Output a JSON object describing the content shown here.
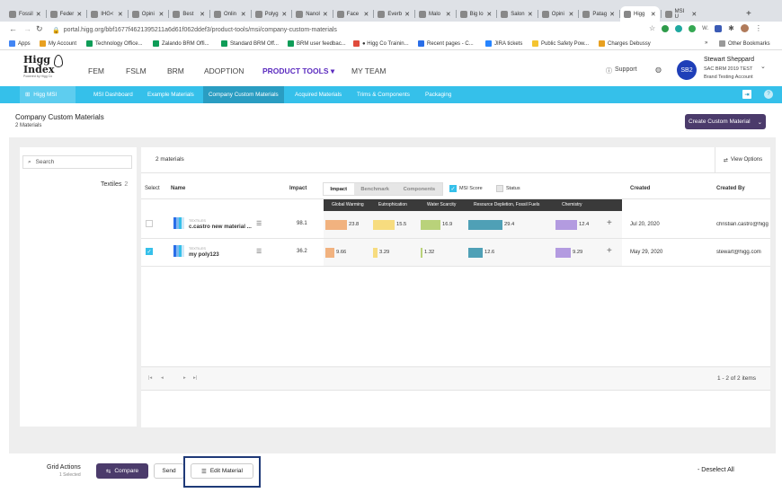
{
  "browser": {
    "tabs": [
      {
        "label": "Fossil",
        "icon": "qz-icon"
      },
      {
        "label": "Feder",
        "icon": "globe-icon"
      },
      {
        "label": "IHG<",
        "icon": "ihg-icon"
      },
      {
        "label": "Opini",
        "icon": "e-icon"
      },
      {
        "label": "Best",
        "icon": "page-icon"
      },
      {
        "label": "Onlin",
        "icon": "car-icon"
      },
      {
        "label": "Polyg",
        "icon": "orange-icon"
      },
      {
        "label": "Nanol",
        "icon": "page-icon"
      },
      {
        "label": "Face",
        "icon": "u-icon"
      },
      {
        "label": "Everb",
        "icon": "page-icon"
      },
      {
        "label": "Malo",
        "icon": "mug-icon"
      },
      {
        "label": "Big lo",
        "icon": "page-icon"
      },
      {
        "label": "Salon",
        "icon": "salon-icon"
      },
      {
        "label": "Opini",
        "icon": "e-icon"
      },
      {
        "label": "Patag",
        "icon": "page-icon"
      },
      {
        "label": "Higg",
        "icon": "higg-icon"
      },
      {
        "label": "MSI U",
        "icon": "gmail-icon"
      }
    ],
    "new_tab": "+",
    "url": "portal.higg.org/bbf1677f4621395211a6d61f062ddef3/product-tools/msi/company-custom-materials",
    "bookmarks": [
      "Apps",
      "My Account",
      "Technology Office...",
      "Zalando BRM Offi...",
      "Standard BRM Off...",
      "BRM user feedbac...",
      "● Higg Co Trainin...",
      "Recent pages - C...",
      "JIRA tickets",
      "Public Safety Pow...",
      "Charges Debussy"
    ],
    "bookmarks_more": "»",
    "other_bookmarks": "Other Bookmarks"
  },
  "app": {
    "logo_line1": "Higg",
    "logo_line2": "Index",
    "logo_tag": "Powered by Higg Co",
    "nav": [
      "FEM",
      "FSLM",
      "BRM",
      "ADOPTION",
      "PRODUCT TOOLS ▾",
      "MY TEAM"
    ],
    "support": "Support",
    "user_initials": "SB2",
    "user_name": "Stewart Sheppard",
    "user_org": "SAC BRM 2019 TEST",
    "user_account": "Brand Testing Account"
  },
  "subnav": {
    "brand": "Higg MSI",
    "items": [
      "MSI Dashboard",
      "Example Materials",
      "Company Custom Materials",
      "Acquired Materials",
      "Trims & Components",
      "Packaging"
    ]
  },
  "page": {
    "title": "Company Custom Materials",
    "count": "2 Materials",
    "create_button": "Create Custom Material",
    "create_chevron": "⌄"
  },
  "filters": {
    "search_placeholder": "Search",
    "category": "Textiles",
    "category_count": "2"
  },
  "grid": {
    "materials_count": "2 materials",
    "view_options": "View Options",
    "headers": {
      "select": "Select",
      "name": "Name",
      "impact": "Impact",
      "created": "Created",
      "created_by": "Created By"
    },
    "impact_tabs": [
      "Impact",
      "Benchmark",
      "Components"
    ],
    "msi_score_label": "MSI Score",
    "status_label": "Status",
    "impact_columns": [
      "Global Warming",
      "Eutrophication",
      "Water Scarcity",
      "Resource Depletion, Fossil Fuels",
      "Chemistry"
    ],
    "rows": [
      {
        "category": "TEXTILES",
        "name": "c.castro new material ...",
        "impact": "98.1",
        "values": [
          "23.8",
          "15.5",
          "16.9",
          "29.4",
          "12.4"
        ],
        "fills": [
          0.63,
          0.62,
          0.59,
          0.62,
          0.62
        ],
        "created": "Jul 20, 2020",
        "created_by": "christian.castro@higg",
        "selected": false
      },
      {
        "category": "TEXTILES",
        "name": "my poly123",
        "impact": "36.2",
        "values": [
          "9.66",
          "3.29",
          "1.32",
          "12.6",
          "9.29"
        ],
        "fills": [
          0.26,
          0.13,
          0.05,
          0.26,
          0.46
        ],
        "created": "May 29, 2020",
        "created_by": "stewart@higg.com",
        "selected": true
      }
    ],
    "pager": [
      "|◂",
      "◂",
      "▸",
      "▸|"
    ],
    "range": "1 - 2 of 2 items"
  },
  "footer": {
    "title": "Grid Actions",
    "selected": "1 Selected",
    "compare": "Compare",
    "send": "Send",
    "edit": "Edit Material",
    "deselect": "- Deselect All"
  },
  "colors": {
    "accent": "#35c0ea",
    "subnav_active": "#2a9dc2",
    "brand_purple": "#4b3b6b",
    "nav_purple": "#5b2bbf",
    "bar_colors": [
      "#f1b27f",
      "#f7dc7f",
      "#b9d27a",
      "#4fa0b6",
      "#b39be0"
    ]
  }
}
